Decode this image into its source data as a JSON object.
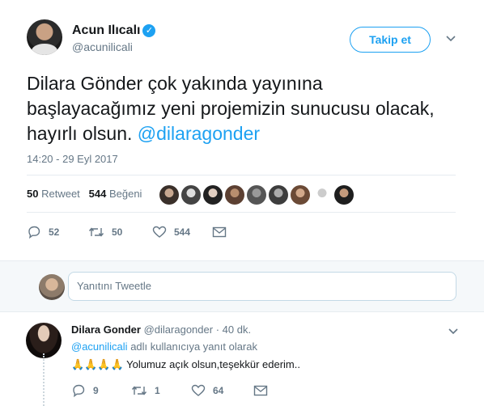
{
  "tweet": {
    "author_name": "Acun Ilıcalı",
    "verified_glyph": "✓",
    "handle": "@acunilicali",
    "follow_label": "Takip et",
    "text_main": "Dilara Gönder çok yakında yayınına başlayacağımız yeni projemizin sunucusu olacak, hayırlı olsun.",
    "text_mention": "@dilaragonder",
    "timestamp": "14:20 - 29 Eyl 2017",
    "retweet_count": "50",
    "retweet_label": "Retweet",
    "like_count": "544",
    "like_label": "Beğeni",
    "actions": {
      "reply_count": "52",
      "retweet_count": "50",
      "like_count": "544"
    }
  },
  "reply_box": {
    "placeholder": "Yanıtını Tweetle"
  },
  "reply": {
    "author_name": "Dilara Gonder",
    "handle": "@dilaragonder",
    "separator": "·",
    "time": "40 dk.",
    "replying_mention": "@acunilicali",
    "replying_suffix": "adlı kullanıcıya yanıt olarak",
    "emoji": "🙏🙏🙏🙏",
    "text": "Yolumuz açık olsun,teşekkür ederim..",
    "actions": {
      "reply_count": "9",
      "retweet_count": "1",
      "like_count": "64"
    }
  },
  "colors": {
    "accent": "#1da1f2",
    "secondary_text": "#657786",
    "divider": "#e6ecf0"
  },
  "icons": [
    "verified-icon",
    "chevron-down-icon",
    "reply-icon",
    "retweet-icon",
    "like-icon",
    "message-icon"
  ]
}
